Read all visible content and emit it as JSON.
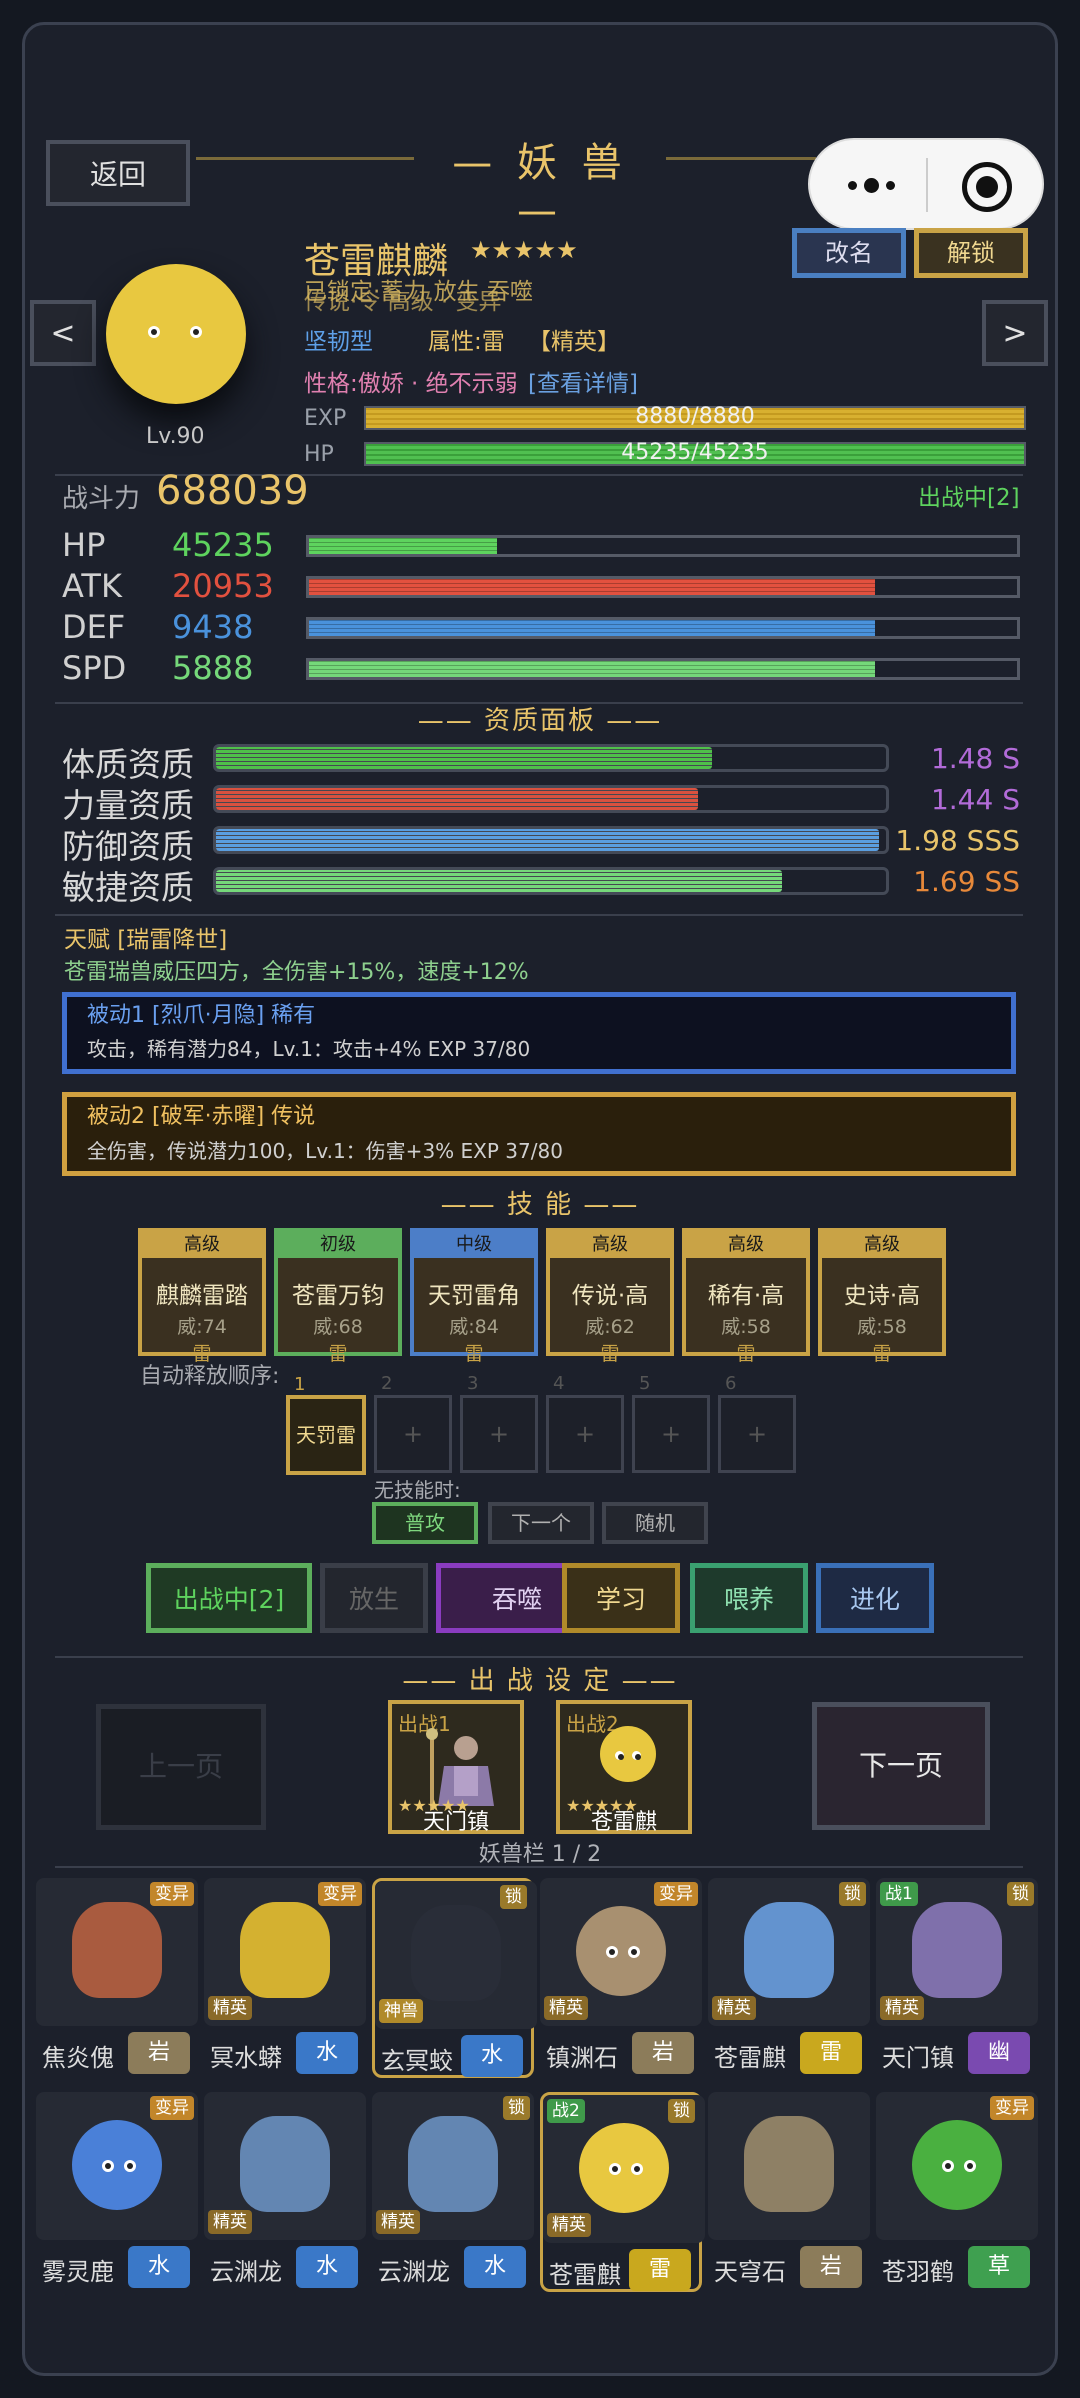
{
  "header": {
    "back": "返回",
    "title": "— 妖 兽 —",
    "rename": "改名",
    "unlock": "解锁",
    "prev": "<",
    "next": ">"
  },
  "pet": {
    "name": "苍雷麒麟",
    "stars": "★★★★★",
    "overlap_line1": "已锁定·蓄力 放生 吞噬",
    "overlap_line2": "传说·令 高级 · 变异",
    "type": "坚韧型",
    "attr": "属性:雷",
    "grade": "【精英】",
    "personality": "性格:傲娇 · 绝不示弱",
    "detail_link": "[查看详情]",
    "level": "Lv.90",
    "exp_label": "EXP",
    "exp": "8880/8880",
    "exp_frac": 1.0,
    "hp_label": "HP",
    "hp": "45235/45235",
    "hp_frac": 1.0,
    "power_label": "战斗力",
    "power": "688039",
    "battle_status": "出战中[2]"
  },
  "stats": [
    {
      "label": "HP",
      "value": "45235",
      "color": "#5ed35e",
      "frac": 0.265
    },
    {
      "label": "ATK",
      "value": "20953",
      "color": "#e2513f",
      "frac": 0.8
    },
    {
      "label": "DEF",
      "value": "9438",
      "color": "#4a92dc",
      "frac": 0.8
    },
    {
      "label": "SPD",
      "value": "5888",
      "color": "#75d87a",
      "frac": 0.8
    }
  ],
  "aptitude": {
    "title": "—— 资质面板 ——",
    "rows": [
      {
        "label": "体质资质",
        "value": "1.48 S",
        "color": "#4fc04a",
        "frac": 0.74,
        "vcolor": "#b26bd8"
      },
      {
        "label": "力量资质",
        "value": "1.44 S",
        "color": "#d9513f",
        "frac": 0.72,
        "vcolor": "#b26bd8"
      },
      {
        "label": "防御资质",
        "value": "1.98 SSS",
        "color": "#5a9ee0",
        "frac": 0.99,
        "vcolor": "#e9c46a"
      },
      {
        "label": "敏捷资质",
        "value": "1.69 SS",
        "color": "#75d87a",
        "frac": 0.845,
        "vcolor": "#e8893a"
      }
    ]
  },
  "talent": {
    "title": "天赋 [瑞雷降世]",
    "desc": "苍雷瑞兽威压四方，全伤害+15%，速度+12%"
  },
  "passives": [
    {
      "title": "被动1 [烈爪·月隐] 稀有",
      "desc": "攻击，稀有潜力84，Lv.1：攻击+4%  EXP 37/80"
    },
    {
      "title": "被动2 [破军·赤曜] 传说",
      "desc": "全伤害，传说潜力100，Lv.1：伤害+3%  EXP 37/80"
    }
  ],
  "skills_title": "—— 技 能 ——",
  "skills": [
    {
      "tier": "高级",
      "name": "麒麟雷踏",
      "power": "威:74",
      "elem": "雷",
      "border": "#c9a346",
      "tierbg": "#c9a346"
    },
    {
      "tier": "初级",
      "name": "苍雷万钧",
      "power": "威:68",
      "elem": "雷",
      "border": "#5cae5c",
      "tierbg": "#5cae5c"
    },
    {
      "tier": "中级",
      "name": "天罚雷角",
      "power": "威:84",
      "elem": "雷",
      "border": "#4c7ec8",
      "tierbg": "#4c7ec8"
    },
    {
      "tier": "高级",
      "name": "传说·高",
      "power": "威:62",
      "elem": "雷",
      "border": "#c9a346",
      "tierbg": "#c9a346"
    },
    {
      "tier": "高级",
      "name": "稀有·高",
      "power": "威:58",
      "elem": "雷",
      "border": "#c9a346",
      "tierbg": "#c9a346"
    },
    {
      "tier": "高级",
      "name": "史诗·高",
      "power": "威:58",
      "elem": "雷",
      "border": "#c9a346",
      "tierbg": "#c9a346"
    }
  ],
  "auto": {
    "label": "自动释放顺序:",
    "slot1_num": "1",
    "slot1": "天罚雷",
    "slots": [
      "2",
      "3",
      "4",
      "5",
      "6"
    ],
    "plus": "+",
    "no_skill_label": "无技能时:",
    "opts": [
      "普攻",
      "下一个",
      "随机"
    ]
  },
  "actions": [
    {
      "label": "出战中[2]",
      "color": "#5cae5c",
      "text": "#5ed35e",
      "bg": "#1f3a24"
    },
    {
      "label": "放生",
      "color": "#3a3e48",
      "text": "#666",
      "bg": "#23262e"
    },
    {
      "label": "吞噬",
      "color": "#8a3cc0",
      "text": "#e0d0f0",
      "bg": "#3a1e4a"
    },
    {
      "label": "学习",
      "color": "#b08a2a",
      "text": "#f0d890",
      "bg": "#3a3018"
    },
    {
      "label": "喂养",
      "color": "#3aa070",
      "text": "#8ee0b0",
      "bg": "#1e3a2c"
    },
    {
      "label": "进化",
      "color": "#3a70b8",
      "text": "#a8c8f0",
      "bg": "#1e2a44"
    }
  ],
  "battle": {
    "title": "—— 出 战 设 定 ——",
    "prev": "上一页",
    "next": "下一页",
    "slot1_label": "出战1",
    "slot1_name": "天门镇",
    "slot2_label": "出战2",
    "slot2_name": "苍雷麒",
    "stars": "★★★★★",
    "pager": "妖兽栏 1 / 2"
  },
  "roster": [
    {
      "name": "焦炎傀",
      "elem": "岩",
      "ec": "#8c7c5a",
      "tag": "变异",
      "badge": "",
      "battle": ""
    },
    {
      "name": "冥水蟒",
      "elem": "水",
      "ec": "#3a78c8",
      "tag": "变异",
      "badge": "精英",
      "battle": ""
    },
    {
      "name": "玄冥蛟",
      "elem": "水",
      "ec": "#3a78c8",
      "tag": "锁",
      "badge": "神兽",
      "battle": ""
    },
    {
      "name": "镇渊石",
      "elem": "岩",
      "ec": "#8c7c5a",
      "tag": "变异",
      "badge": "精英",
      "battle": ""
    },
    {
      "name": "苍雷麒",
      "elem": "雷",
      "ec": "#c9a81e",
      "tag": "锁",
      "badge": "精英",
      "battle": ""
    },
    {
      "name": "天门镇",
      "elem": "幽",
      "ec": "#7a4ab0",
      "tag": "锁",
      "badge": "精英",
      "battle": "战1"
    },
    {
      "name": "雾灵鹿",
      "elem": "水",
      "ec": "#3a78c8",
      "tag": "变异",
      "badge": "",
      "battle": ""
    },
    {
      "name": "云渊龙",
      "elem": "水",
      "ec": "#3a78c8",
      "tag": "",
      "badge": "精英",
      "battle": ""
    },
    {
      "name": "云渊龙",
      "elem": "水",
      "ec": "#3a78c8",
      "tag": "锁",
      "badge": "精英",
      "battle": ""
    },
    {
      "name": "苍雷麒",
      "elem": "雷",
      "ec": "#c9a81e",
      "tag": "锁",
      "badge": "精英",
      "battle": "战2"
    },
    {
      "name": "天穹石",
      "elem": "岩",
      "ec": "#8c7c5a",
      "tag": "",
      "badge": "",
      "battle": ""
    },
    {
      "name": "苍羽鹤",
      "elem": "草",
      "ec": "#3fa050",
      "tag": "变异",
      "badge": "",
      "battle": ""
    }
  ]
}
